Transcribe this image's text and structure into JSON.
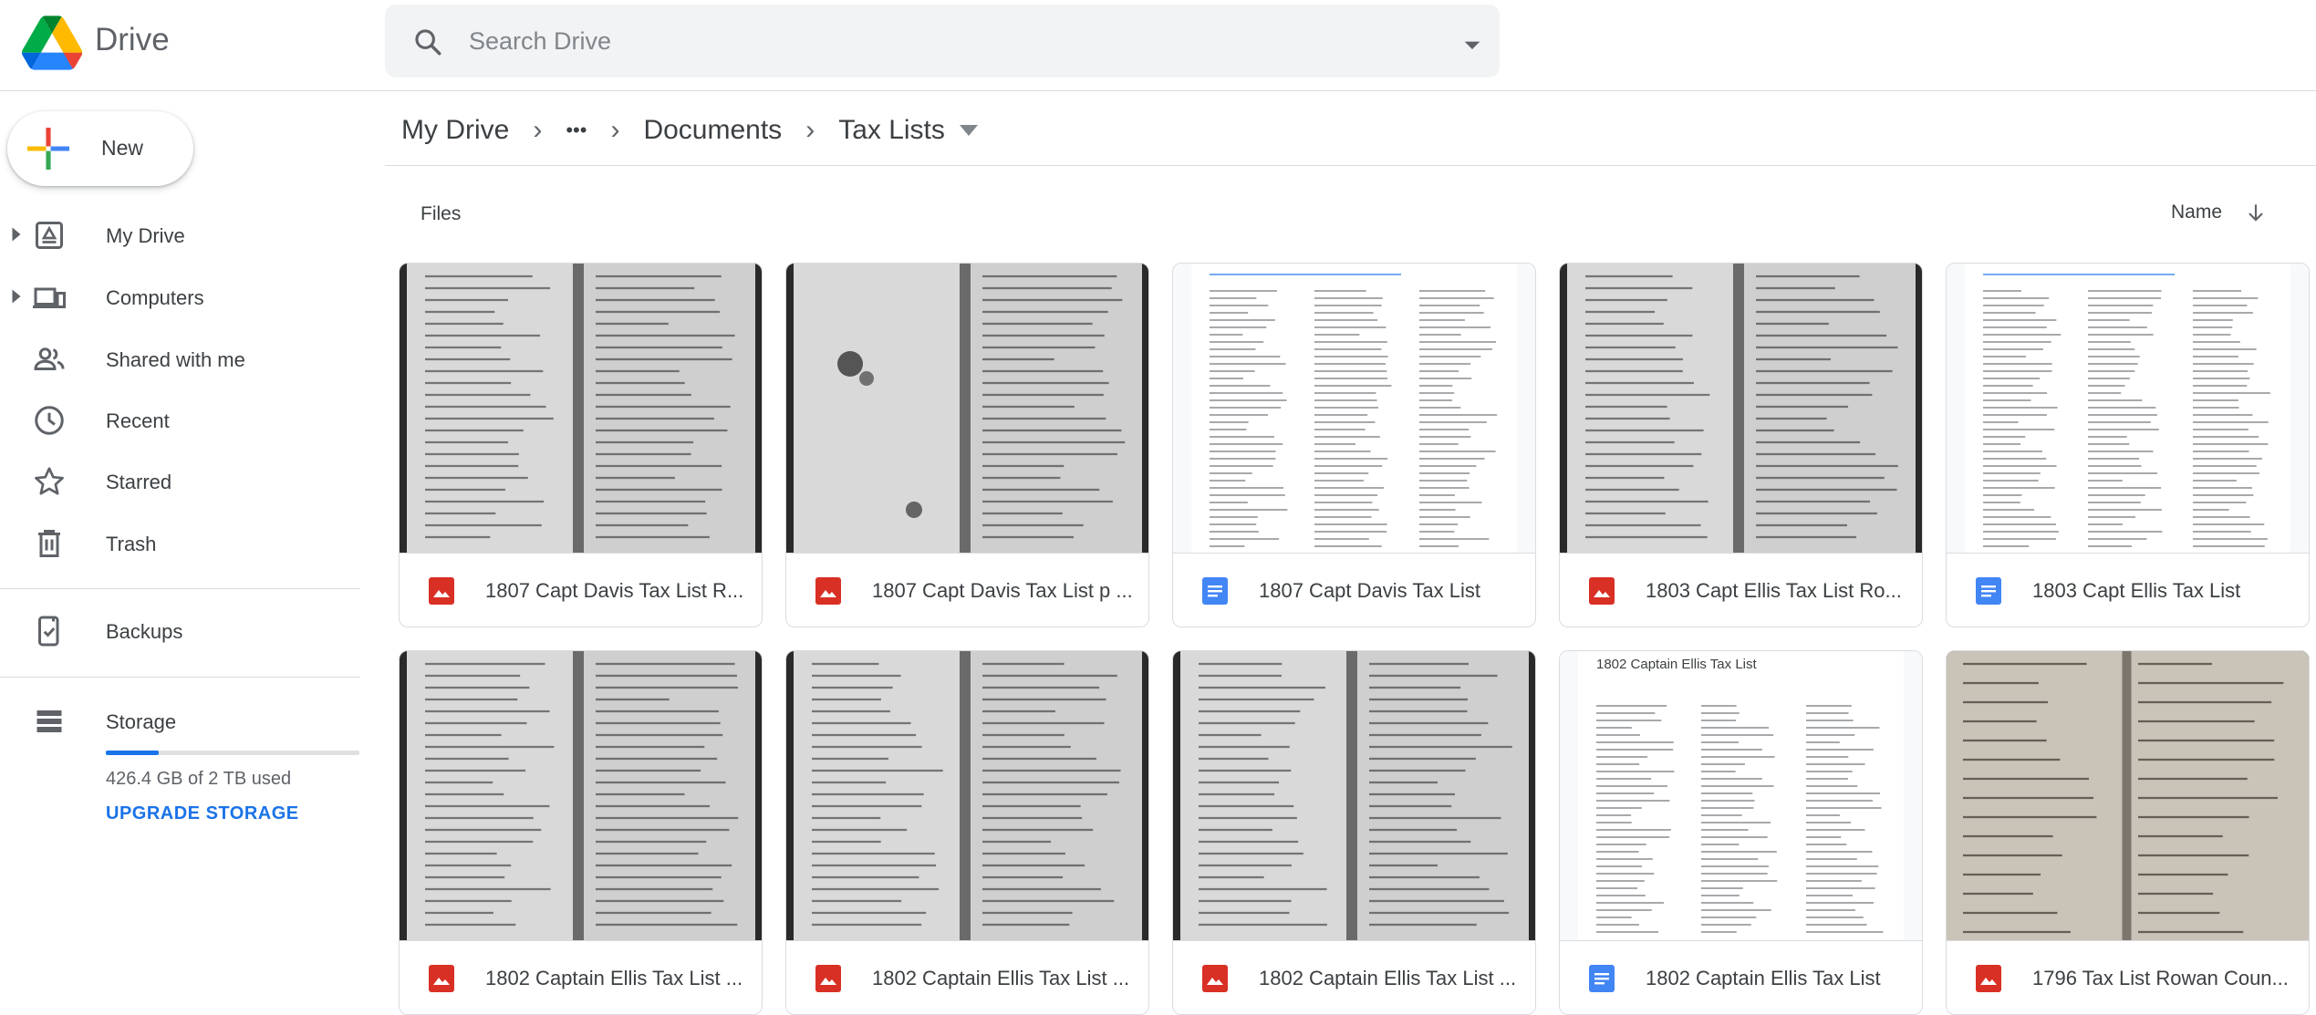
{
  "header": {
    "app_name": "Drive",
    "search_placeholder": "Search Drive"
  },
  "sidebar": {
    "new_label": "New",
    "items": [
      {
        "label": "My Drive",
        "icon": "drive-icon",
        "expandable": true
      },
      {
        "label": "Computers",
        "icon": "computers-icon",
        "expandable": true
      },
      {
        "label": "Shared with me",
        "icon": "people-icon",
        "expandable": false
      },
      {
        "label": "Recent",
        "icon": "clock-icon",
        "expandable": false
      },
      {
        "label": "Starred",
        "icon": "star-icon",
        "expandable": false
      },
      {
        "label": "Trash",
        "icon": "trash-icon",
        "expandable": false
      }
    ],
    "backups": {
      "label": "Backups",
      "icon": "backups-icon"
    },
    "storage": {
      "label": "Storage",
      "icon": "storage-icon",
      "used_text": "426.4 GB of 2 TB used",
      "used_fraction": 0.21,
      "upgrade_label": "UPGRADE STORAGE"
    }
  },
  "breadcrumb": {
    "items": [
      "My Drive",
      "•••",
      "Documents",
      "Tax Lists"
    ]
  },
  "content": {
    "section_label": "Files",
    "sort_label": "Name",
    "files": [
      {
        "name": "1807 Capt Davis Tax List R...",
        "type": "image",
        "thumb": "scan-book"
      },
      {
        "name": "1807 Capt Davis Tax List p ...",
        "type": "image",
        "thumb": "scan-book-blotched"
      },
      {
        "name": "1807 Capt Davis Tax List",
        "type": "doc",
        "thumb": "doc-columns"
      },
      {
        "name": "1803 Capt Ellis Tax List Ro...",
        "type": "image",
        "thumb": "scan-book"
      },
      {
        "name": "1803 Capt Ellis Tax List",
        "type": "doc",
        "thumb": "doc-columns"
      },
      {
        "name": "1802 Captain Ellis Tax List ...",
        "type": "image",
        "thumb": "scan-book"
      },
      {
        "name": "1802 Captain Ellis Tax List ...",
        "type": "image",
        "thumb": "scan-book"
      },
      {
        "name": "1802 Captain Ellis Tax List ...",
        "type": "image",
        "thumb": "scan-book"
      },
      {
        "name": "1802 Captain Ellis Tax List",
        "type": "doc",
        "thumb": "doc-columns"
      },
      {
        "name": "1796 Tax List Rowan Coun...",
        "type": "image",
        "thumb": "scan-handwritten"
      }
    ],
    "doc_preview_title": "1802 Captain Ellis Tax List"
  },
  "colors": {
    "accent": "#1a73e8",
    "image_icon": "#d93025",
    "doc_icon": "#4285f4"
  }
}
